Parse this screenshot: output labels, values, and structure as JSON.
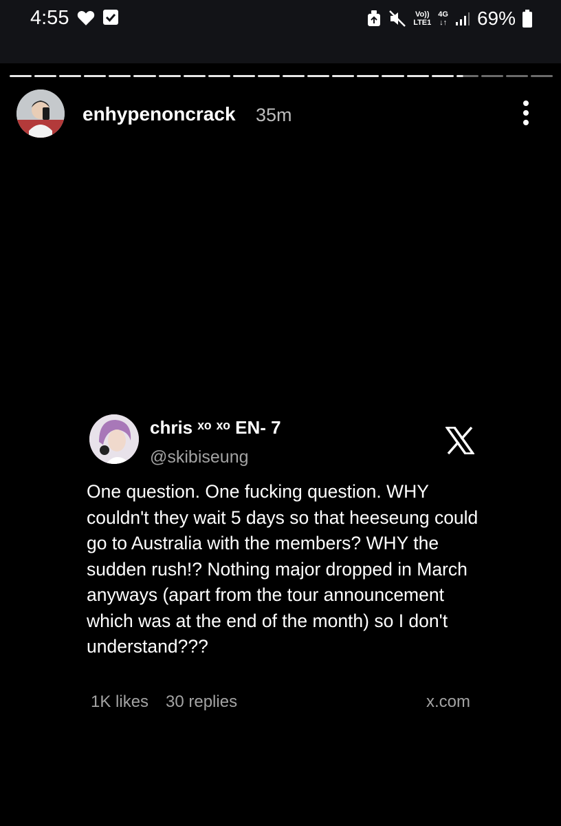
{
  "status_bar": {
    "time": "4:55",
    "icons": [
      "heart-icon",
      "check-icon",
      "recycle-icon",
      "mute-icon",
      "volte-icon",
      "4g-icon",
      "signal-icon",
      "battery-icon"
    ],
    "volte_line1": "Vo))",
    "volte_line2": "LTE1",
    "network_line1": "4G",
    "network_line2": "↓↑",
    "battery": "69%"
  },
  "story": {
    "username": "enhypenoncrack",
    "time_ago": "35m",
    "progress": {
      "segments": 22,
      "completed": 18,
      "current_fraction": 0.3
    }
  },
  "tweet": {
    "display_name": "chris ˣᵒ ˣᵒ EN- 7",
    "handle": "@skibiseung",
    "text": "One question. One fucking question. WHY couldn't they wait 5 days so that heeseung could go to Australia with the members? WHY the sudden rush!? Nothing major dropped in March anyways (apart from the tour announcement which was at the end of the month) so I don't understand???",
    "likes": "1K likes",
    "replies": "30 replies",
    "domain": "x.com"
  },
  "colors": {
    "background": "#000000",
    "status_bar": "#121317",
    "muted_text": "#a3a3a3",
    "progress_done": "#e8e8e8",
    "progress_pending": "#6b6b6b"
  }
}
